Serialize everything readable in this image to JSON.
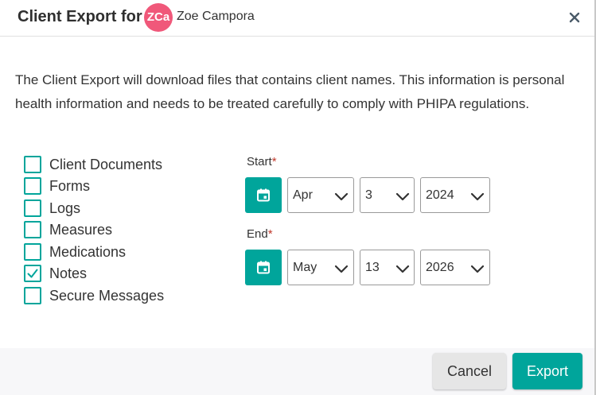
{
  "dialog": {
    "title": "Client Export for",
    "client": {
      "initials": "ZCa",
      "name": "Zoe Campora",
      "avatar_color": "#f0587a"
    },
    "close_icon": "close-icon"
  },
  "description": "The Client Export will download files that contains client names. This information is personal health information and needs to be treated carefully to comply with PHIPA regulations.",
  "export_options": [
    {
      "label": "Client Documents",
      "checked": false
    },
    {
      "label": "Forms",
      "checked": false
    },
    {
      "label": "Logs",
      "checked": false
    },
    {
      "label": "Measures",
      "checked": false
    },
    {
      "label": "Medications",
      "checked": false
    },
    {
      "label": "Notes",
      "checked": true
    },
    {
      "label": "Secure Messages",
      "checked": false
    }
  ],
  "start": {
    "label": "Start",
    "required_mark": "*",
    "month": "Apr",
    "day": "3",
    "year": "2024"
  },
  "end": {
    "label": "End",
    "required_mark": "*",
    "month": "May",
    "day": "13",
    "year": "2026"
  },
  "icons": {
    "calendar": "calendar-icon",
    "dropdown": "chevron-down-icon",
    "check": "checkmark-icon"
  },
  "footer": {
    "cancel_label": "Cancel",
    "export_label": "Export"
  },
  "colors": {
    "accent": "#00a59b",
    "required": "#c0392b"
  }
}
